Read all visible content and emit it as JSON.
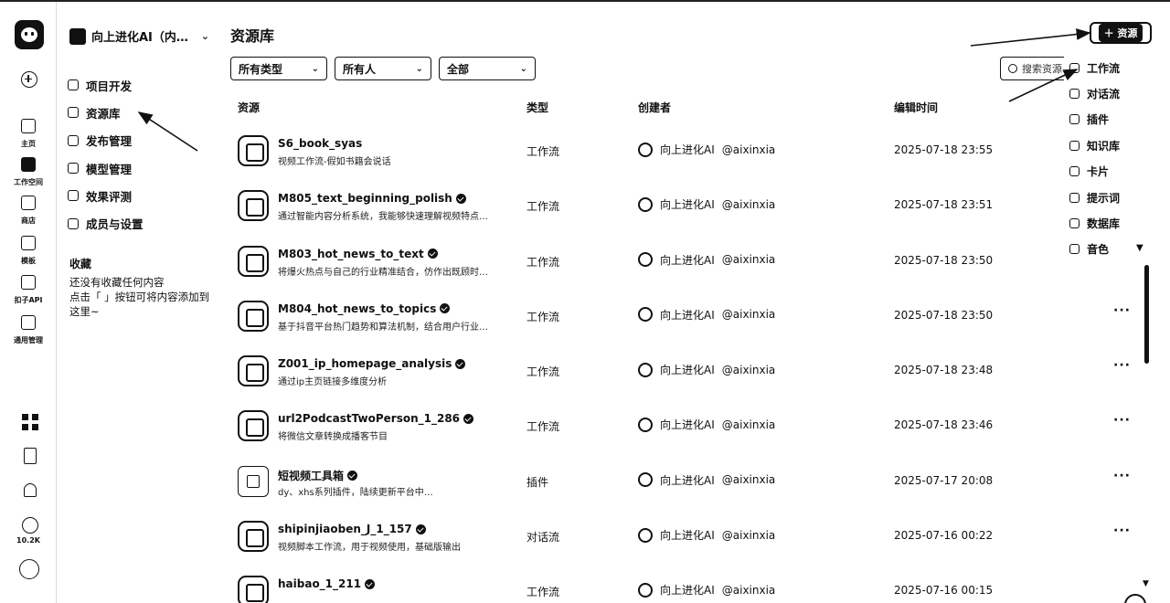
{
  "rail": {
    "items": [
      {
        "label": "主页",
        "icon": "home-icon"
      },
      {
        "label": "工作空间",
        "icon": "workspace-icon"
      },
      {
        "label": "商店",
        "icon": "store-icon"
      },
      {
        "label": "模板",
        "icon": "template-icon"
      },
      {
        "label": "扣子API",
        "icon": "api-icon"
      },
      {
        "label": "通用管理",
        "icon": "manage-icon"
      }
    ],
    "star_count": "10.2K"
  },
  "sidebar": {
    "workspace_name": "向上进化AI（内…",
    "nav": [
      {
        "label": "项目开发",
        "icon": "project-icon"
      },
      {
        "label": "资源库",
        "icon": "library-icon"
      },
      {
        "label": "发布管理",
        "icon": "rocket-icon"
      },
      {
        "label": "模型管理",
        "icon": "model-icon"
      },
      {
        "label": "效果评测",
        "icon": "evaluation-icon"
      },
      {
        "label": "成员与设置",
        "icon": "members-icon"
      }
    ],
    "favorites_title": "收藏",
    "favorites_empty_line1": "还没有收藏任何内容",
    "favorites_empty_line2": "点击「 」按钮可将内容添加到",
    "favorites_empty_line3": "这里~"
  },
  "main": {
    "title": "资源库",
    "add_button": "资源",
    "filters": [
      "所有类型",
      "所有人",
      "全部"
    ],
    "search_placeholder": "搜索资源",
    "columns": {
      "resource": "资源",
      "type": "类型",
      "creator": "创建者",
      "edited": "编辑时间"
    },
    "rows": [
      {
        "name": "S6_book_syas",
        "desc": "视频工作流-假如书籍会说话",
        "type": "工作流",
        "creator": "向上进化AI",
        "handle": "@aixinxia",
        "time": "2025-07-18 23:55",
        "verified": false
      },
      {
        "name": "M805_text_beginning_polish",
        "desc": "通过智能内容分析系统，我能够快速理解视频特点…",
        "type": "工作流",
        "creator": "向上进化AI",
        "handle": "@aixinxia",
        "time": "2025-07-18 23:51",
        "verified": true
      },
      {
        "name": "M803_hot_news_to_text",
        "desc": "将爆火热点与自己的行业精准结合，仿作出既顾时…",
        "type": "工作流",
        "creator": "向上进化AI",
        "handle": "@aixinxia",
        "time": "2025-07-18 23:50",
        "verified": true
      },
      {
        "name": "M804_hot_news_to_topics",
        "desc": "基于抖音平台热门趋势和算法机制，结合用户行业…",
        "type": "工作流",
        "creator": "向上进化AI",
        "handle": "@aixinxia",
        "time": "2025-07-18 23:50",
        "verified": true
      },
      {
        "name": "Z001_ip_homepage_analysis",
        "desc": "通过ip主页链接多维度分析",
        "type": "工作流",
        "creator": "向上进化AI",
        "handle": "@aixinxia",
        "time": "2025-07-18 23:48",
        "verified": true
      },
      {
        "name": "url2PodcastTwoPerson_1_286",
        "desc": "将微信文章转换成播客节目",
        "type": "工作流",
        "creator": "向上进化AI",
        "handle": "@aixinxia",
        "time": "2025-07-18 23:46",
        "verified": true
      },
      {
        "name": "短视频工具箱",
        "desc": "dy、xhs系列插件，陆续更新平台中…",
        "type": "插件",
        "creator": "向上进化AI",
        "handle": "@aixinxia",
        "time": "2025-07-17 20:08",
        "verified": true
      },
      {
        "name": "shipinjiaoben_J_1_157",
        "desc": "视频脚本工作流，用于视频使用，基础版输出",
        "type": "对话流",
        "creator": "向上进化AI",
        "handle": "@aixinxia",
        "time": "2025-07-16 00:22",
        "verified": true
      },
      {
        "name": "haibao_1_211",
        "desc": "",
        "type": "工作流",
        "creator": "向上进化AI",
        "handle": "@aixinxia",
        "time": "2025-07-16 00:15",
        "verified": true
      }
    ],
    "more_label": "···"
  },
  "dropdown": {
    "items": [
      {
        "label": "工作流",
        "icon": "workflow-icon"
      },
      {
        "label": "对话流",
        "icon": "chatflow-icon"
      },
      {
        "label": "插件",
        "icon": "plugin-icon"
      },
      {
        "label": "知识库",
        "icon": "knowledge-icon"
      },
      {
        "label": "卡片",
        "icon": "card-icon"
      },
      {
        "label": "提示词",
        "icon": "prompt-icon"
      },
      {
        "label": "数据库",
        "icon": "database-icon"
      },
      {
        "label": "音色",
        "icon": "voice-icon"
      }
    ]
  }
}
